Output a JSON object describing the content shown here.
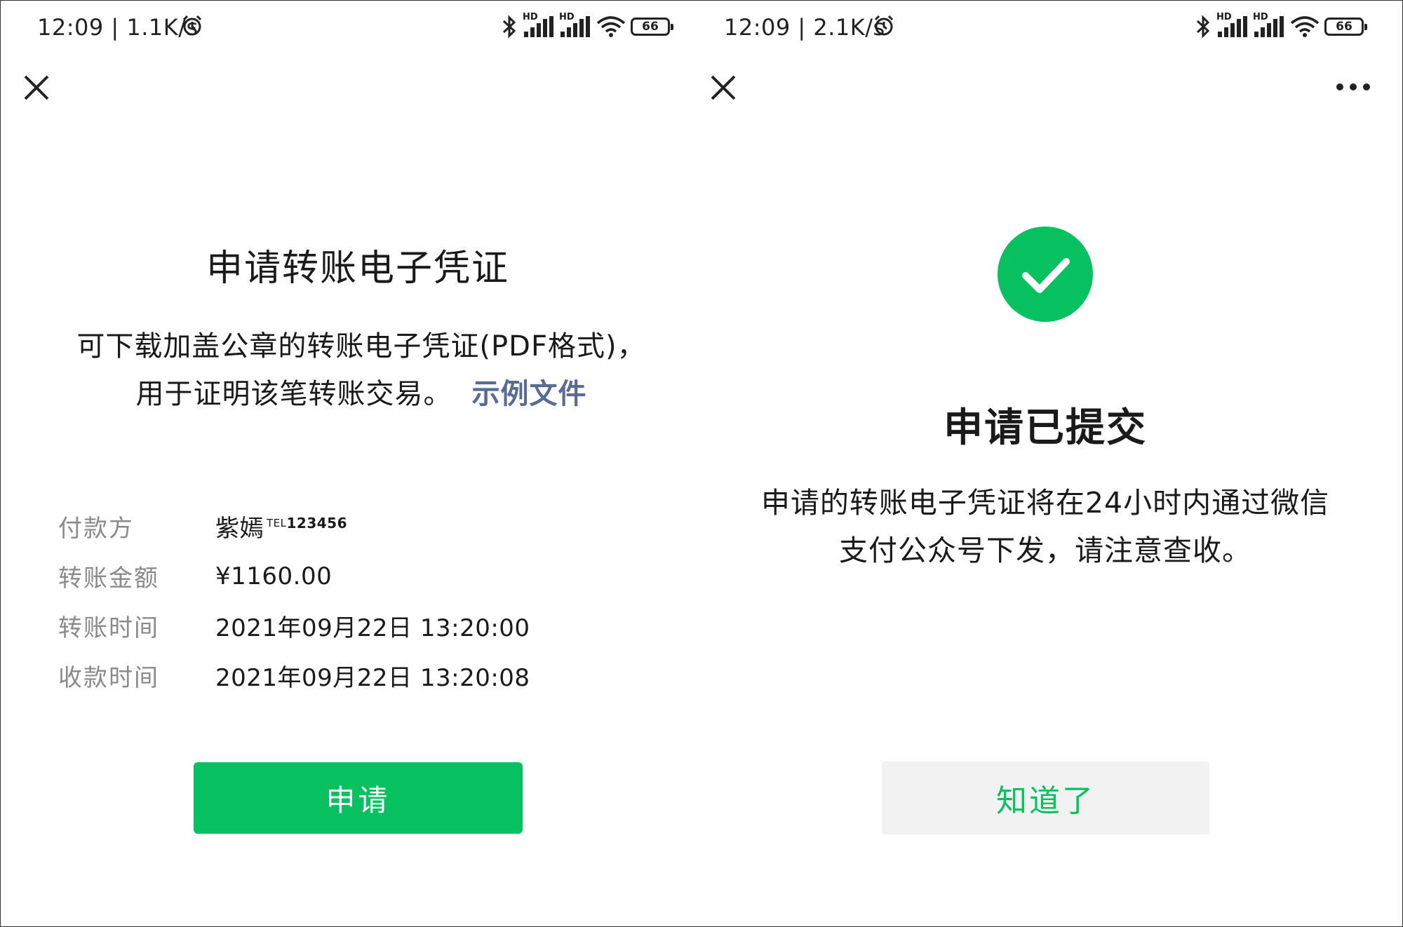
{
  "left": {
    "status": {
      "time": "12:09 | 1.1K/s",
      "battery": "66",
      "signal_tag": "HD"
    },
    "title": "申请转账电子凭证",
    "description": {
      "line1": "可下载加盖公章的转账电子凭证(PDF格式)，",
      "line2": "用于证明该笔转账交易。",
      "link": "示例文件"
    },
    "details": {
      "payer_label": "付款方",
      "payer_value": "紫嫣",
      "payer_tel_prefix": "TEL",
      "payer_tel": "123456",
      "amount_label": "转账金额",
      "amount_value": "¥1160.00",
      "transfer_time_label": "转账时间",
      "transfer_time_value": "2021年09月22日 13:20:00",
      "receive_time_label": "收款时间",
      "receive_time_value": "2021年09月22日 13:20:08"
    },
    "apply_button": "申请"
  },
  "right": {
    "status": {
      "time": "12:09 | 2.1K/s",
      "battery": "66",
      "signal_tag": "HD"
    },
    "title": "申请已提交",
    "description": {
      "line1": "申请的转账电子凭证将在24小时内通过微信",
      "line2": "支付公众号下发，请注意查收。"
    },
    "ok_button": "知道了"
  },
  "colors": {
    "accent_green": "#07c160",
    "link_blue": "#576b95",
    "label_gray": "#8a8a8a",
    "button_gray": "#f2f2f2"
  },
  "icons": [
    "alarm-icon",
    "bluetooth-icon",
    "signal-icon",
    "wifi-icon",
    "battery-icon",
    "close-icon",
    "more-icon",
    "success-check-icon"
  ]
}
